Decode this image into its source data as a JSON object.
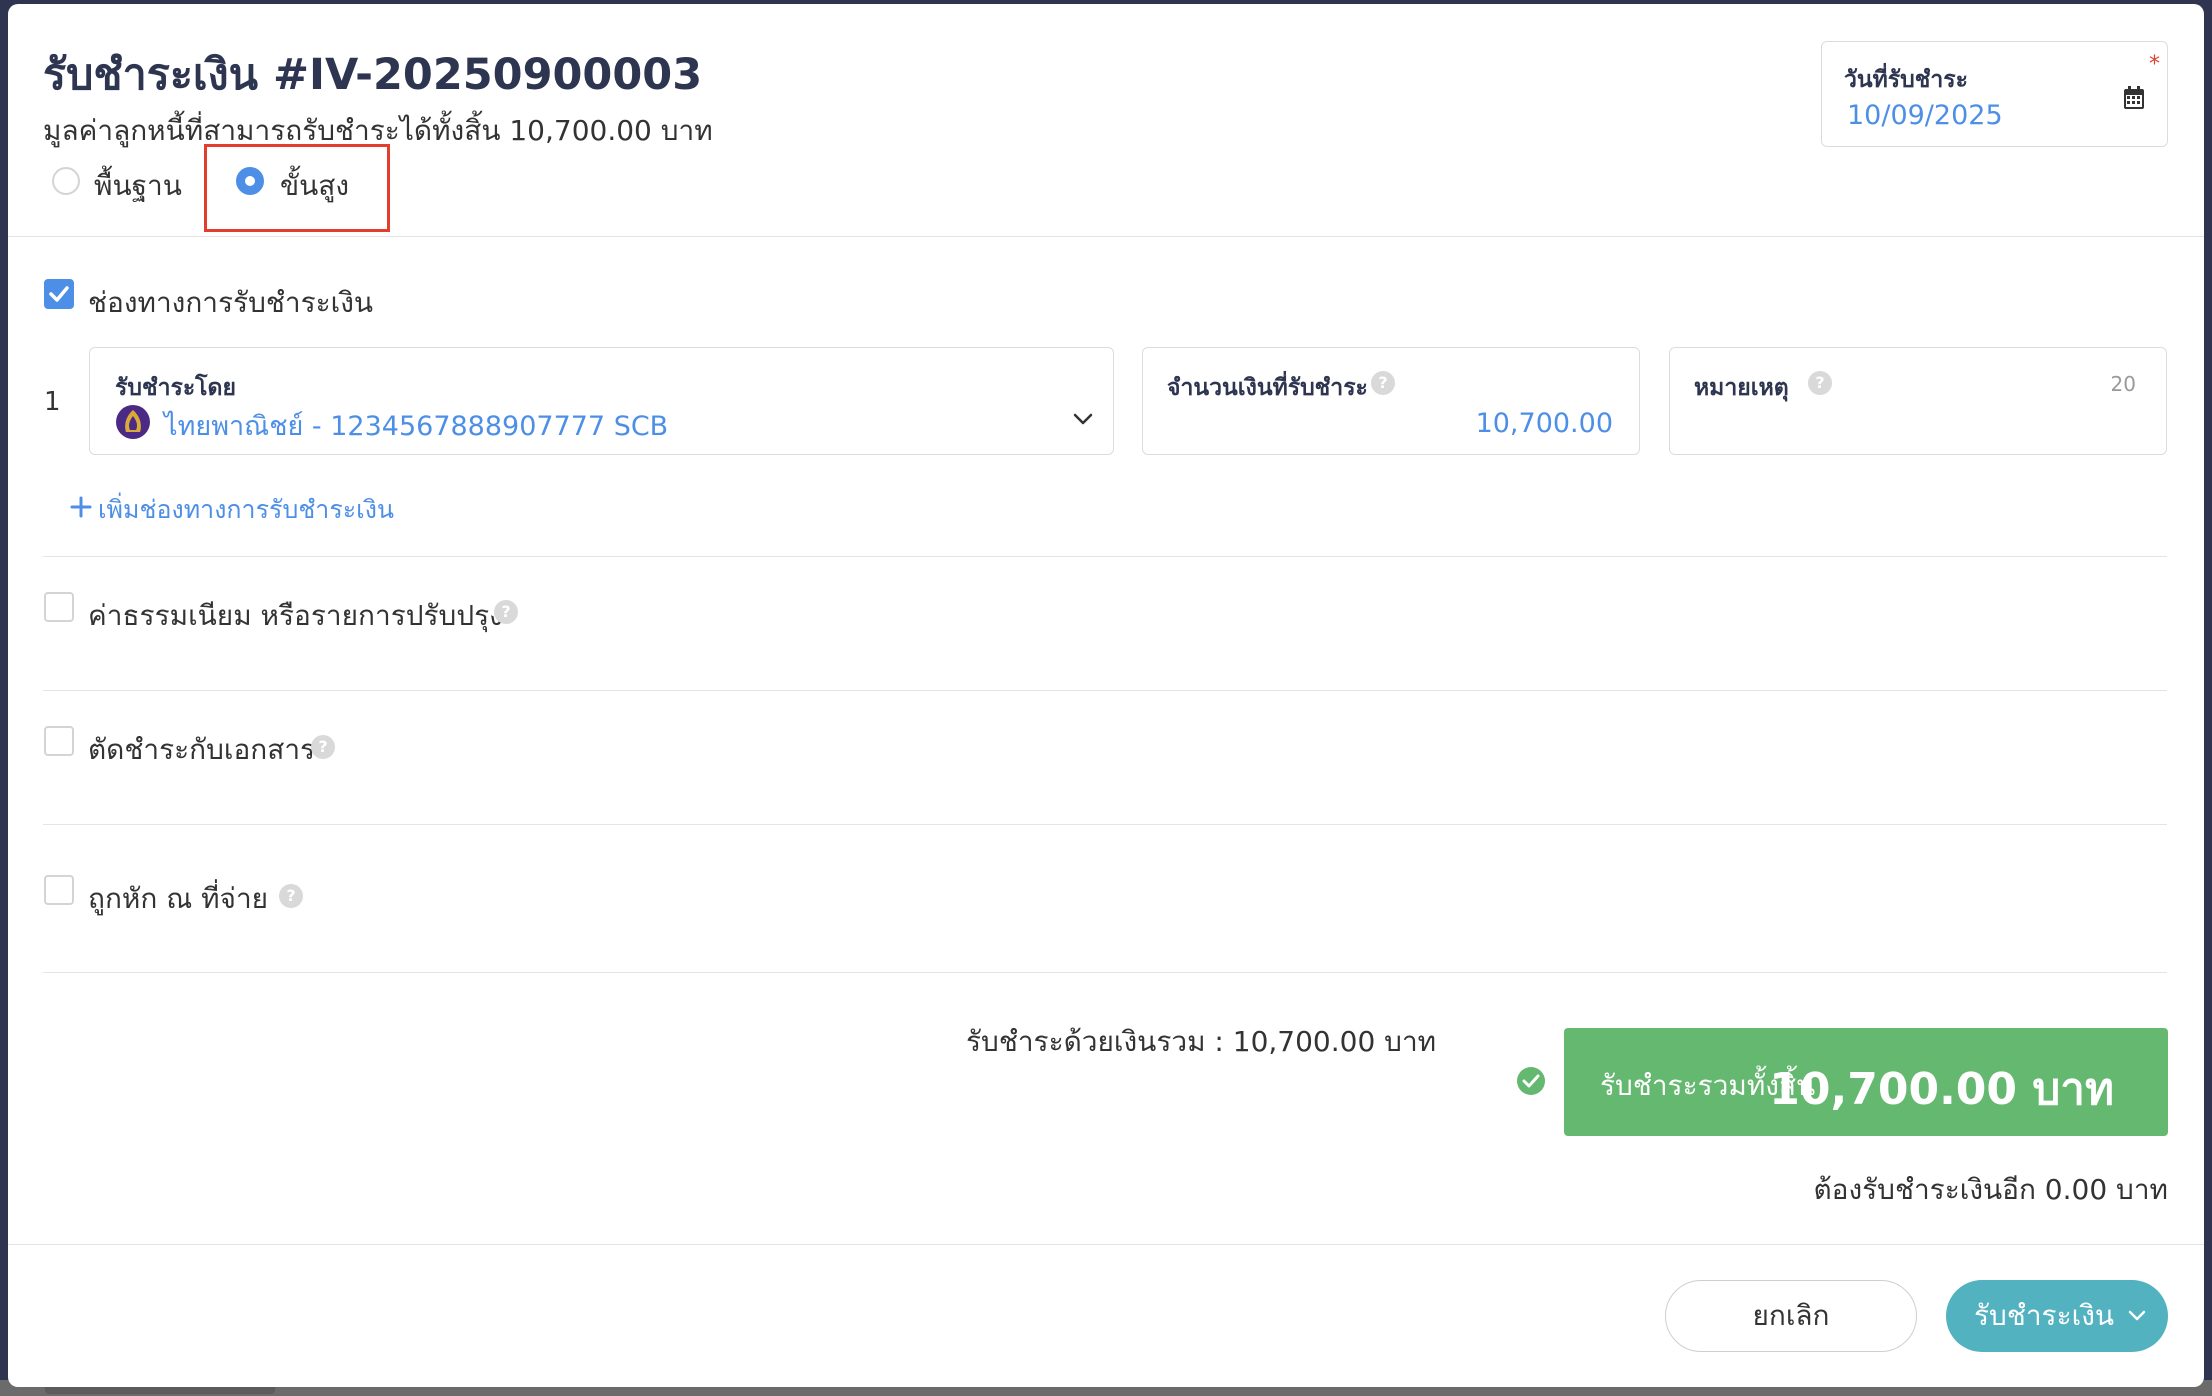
{
  "header": {
    "title": "รับชำระเงิน #IV-20250900003",
    "subtitle": "มูลค่าลูกหนี้ที่สามารถรับชำระได้ทั้งสิ้น 10,700.00 บาท"
  },
  "mode": {
    "options": [
      {
        "label": "พื้นฐาน",
        "selected": false
      },
      {
        "label": "ขั้นสูง",
        "selected": true
      }
    ]
  },
  "date_field": {
    "label": "วันที่รับชำระ",
    "required_mark": "*",
    "value": "10/09/2025",
    "icon": "calendar-icon"
  },
  "payment_channels": {
    "label": "ช่องทางการรับชำระเงิน",
    "checked": true,
    "rows": [
      {
        "index": "1",
        "method_label": "รับชำระโดย",
        "method_value": "ไทยพาณิชย์ - 1234567888907777 SCB",
        "amount_label": "จำนวนเงินที่รับชำระ",
        "amount_value": "10,700.00",
        "note_label": "หมายเหตุ",
        "note_counter": "20",
        "note_value": ""
      }
    ],
    "add_label": "เพิ่มช่องทางการรับชำระเงิน"
  },
  "options": [
    {
      "label": "ค่าธรรมเนียม หรือรายการปรับปรุง",
      "checked": false
    },
    {
      "label": "ตัดชำระกับเอกสาร",
      "checked": false
    },
    {
      "label": "ถูกหัก ณ ที่จ่าย",
      "checked": false
    }
  ],
  "summary": {
    "total_text": "รับชำระด้วยเงินรวม :  10,700.00 บาท",
    "grand_label": "รับชำระรวมทั้งสิ้น",
    "grand_value": "10,700.00 บาท",
    "remaining_text": "ต้องรับชำระเงินอีก 0.00 บาท"
  },
  "footer": {
    "cancel_label": "ยกเลิก",
    "submit_label": "รับชำระเงิน"
  },
  "colors": {
    "accent_blue": "#4d8fe6",
    "success_green": "#65b86f",
    "submit_teal": "#52b2c0",
    "highlight_red": "#e23d2d",
    "scb_purple": "#4b2a85"
  }
}
